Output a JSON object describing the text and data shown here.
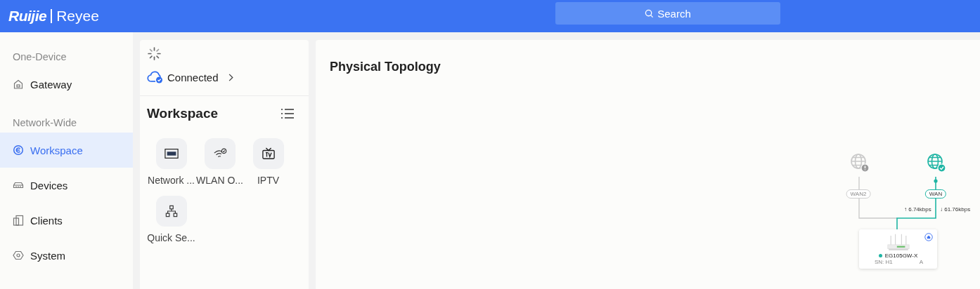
{
  "header": {
    "logo": {
      "brand": "Ruijie",
      "product": "Reyee"
    },
    "search": {
      "label": "Search"
    }
  },
  "sidebar": {
    "sections": [
      {
        "title": "One-Device",
        "items": [
          {
            "label": "Gateway",
            "selected": false
          }
        ]
      },
      {
        "title": "Network-Wide",
        "items": [
          {
            "label": "Workspace",
            "selected": true
          },
          {
            "label": "Devices",
            "selected": false
          },
          {
            "label": "Clients",
            "selected": false
          },
          {
            "label": "System",
            "selected": false
          }
        ]
      }
    ]
  },
  "status_card": {
    "status": "Connected",
    "connected": true
  },
  "workspace": {
    "title": "Workspace",
    "tiles": [
      {
        "label": "Network ..."
      },
      {
        "label": "WLAN O..."
      },
      {
        "label": "IPTV"
      },
      {
        "label": "Quick Se..."
      }
    ]
  },
  "topology": {
    "title": "Physical Topology",
    "wans": [
      {
        "label": "WAN2",
        "connected": false
      },
      {
        "label": "WAN",
        "connected": true
      }
    ],
    "upload": "↑ 6.74kbps",
    "download": "↓ 61.76kbps",
    "device": {
      "model": "EG105GW-X",
      "online": true,
      "sn_start": "SN: H1",
      "sn_end": "A"
    }
  }
}
